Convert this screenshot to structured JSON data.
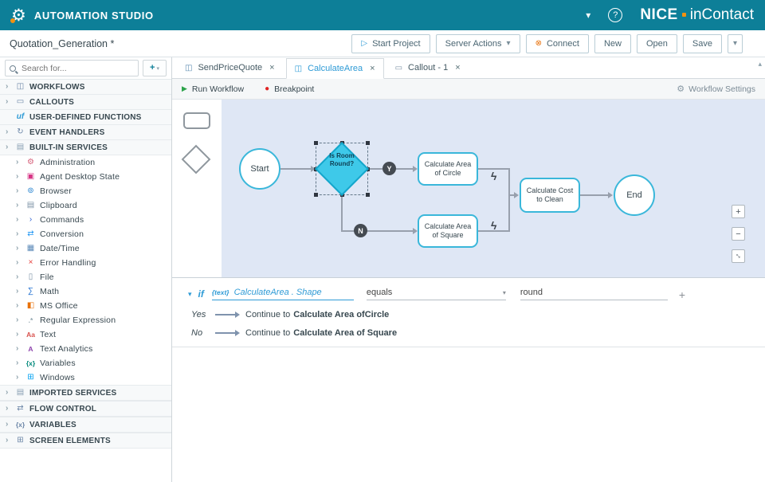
{
  "header": {
    "gear_icon": "⚙",
    "title": "AUTOMATION STUDIO",
    "chevron": "▾",
    "help": "?",
    "brand_nice": "NICE",
    "brand_incontact": "inContact"
  },
  "toolbar": {
    "project": "Quotation_Generation *",
    "start_icon": "▷",
    "start_project": "Start Project",
    "server_actions": "Server Actions",
    "dropdown_icon": "▾",
    "connect_icon": "⊗",
    "connect": "Connect",
    "new": "New",
    "open": "Open",
    "save": "Save"
  },
  "sidebar": {
    "search_placeholder": "Search for...",
    "add_icon": "+",
    "add_dd_icon": "▾",
    "sections": [
      {
        "label": "WORKFLOWS",
        "icon": "◫",
        "color": "#6d87a8"
      },
      {
        "label": "CALLOUTS",
        "icon": "▭",
        "color": "#6d87a8"
      },
      {
        "label": "USER-DEFINED FUNCTIONS",
        "icon": "uf",
        "color": "#2f9bd6"
      },
      {
        "label": "EVENT HANDLERS",
        "icon": "↻",
        "color": "#6d87a8"
      },
      {
        "label": "BUILT-IN SERVICES",
        "icon": "▤",
        "color": "#8aa0b4"
      }
    ],
    "services": [
      {
        "name": "Administration",
        "icon": "⚙",
        "color": "#d6607a"
      },
      {
        "name": "Agent Desktop State",
        "icon": "▣",
        "color": "#d63384"
      },
      {
        "name": "Browser",
        "icon": "⊚",
        "color": "#2c86d1"
      },
      {
        "name": "Clipboard",
        "icon": "▤",
        "color": "#7d93a6"
      },
      {
        "name": "Commands",
        "icon": "›",
        "color": "#2c5fd1"
      },
      {
        "name": "Conversion",
        "icon": "⇄",
        "color": "#2196f3"
      },
      {
        "name": "Date/Time",
        "icon": "▦",
        "color": "#5c8ab8"
      },
      {
        "name": "Error Handling",
        "icon": "×",
        "color": "#e53935"
      },
      {
        "name": "File",
        "icon": "▯",
        "color": "#7d93a6"
      },
      {
        "name": "Math",
        "icon": "∑",
        "color": "#1f6fd1"
      },
      {
        "name": "MS Office",
        "icon": "◧",
        "color": "#e8710a"
      },
      {
        "name": "Regular Expression",
        "icon": ".*",
        "color": "#90a4ae"
      },
      {
        "name": "Text",
        "icon": "Aa",
        "color": "#d9534f"
      },
      {
        "name": "Text Analytics",
        "icon": "A",
        "color": "#8e44ad"
      },
      {
        "name": "Variables",
        "icon": "{x}",
        "color": "#00897b"
      },
      {
        "name": "Windows",
        "icon": "⊞",
        "color": "#00a1f1"
      }
    ],
    "bottom_sections": [
      {
        "label": "IMPORTED SERVICES",
        "icon": "▤",
        "color": "#8aa0b4"
      },
      {
        "label": "FLOW CONTROL",
        "icon": "⇄",
        "color": "#6d87a8"
      },
      {
        "label": "VARIABLES",
        "icon": "{x}",
        "color": "#6d87a8"
      },
      {
        "label": "SCREEN ELEMENTS",
        "icon": "⊞",
        "color": "#6d87a8"
      }
    ]
  },
  "tabs": [
    {
      "label": "SendPriceQuote",
      "icon": "◫",
      "icon_color": "#5b8ab0",
      "close": "×"
    },
    {
      "label": "CalculateArea",
      "icon": "◫",
      "icon_color": "#2f9bd6",
      "close": "×"
    },
    {
      "label": "Callout - 1",
      "icon": "▭",
      "icon_color": "#7d93a6",
      "close": "×"
    }
  ],
  "workflow_bar": {
    "run_icon": "▶",
    "run": "Run Workflow",
    "breakpoint_icon": "●",
    "breakpoint": "Breakpoint",
    "settings_icon": "⚙",
    "settings": "Workflow Settings"
  },
  "flow": {
    "start": "Start",
    "decision": "Is Room Round?",
    "yes": "Y",
    "no": "N",
    "calc_circle": "Calculate Area of Circle",
    "calc_square": "Calculate Area of Square",
    "calc_cost": "Calculate Cost to Clean",
    "end": "End",
    "bolt_icon": "ϟ"
  },
  "zoom": {
    "in": "+",
    "out": "−",
    "fit": "↕"
  },
  "condition": {
    "caret": "▾",
    "keyword": "if",
    "type_tag": "{text}",
    "operand": "CalculateArea . Shape",
    "operator": "equals",
    "operator_dd": "▾",
    "value": "round",
    "add": "+",
    "branches": [
      {
        "label": "Yes",
        "prefix": "Continue to",
        "target": "Calculate Area ofCircle"
      },
      {
        "label": "No",
        "prefix": "Continue to",
        "target": "Calculate Area of Square"
      }
    ]
  },
  "colors": {
    "header_bg": "#0d7f98",
    "accent_blue": "#2f9bd6",
    "accent_orange": "#f29111",
    "canvas_bg": "#dfe7f5",
    "node_border": "#3ab7da",
    "decision_fill": "#3ec9e9",
    "run_green": "#2ca34a",
    "breakpoint_red": "#e02424"
  }
}
